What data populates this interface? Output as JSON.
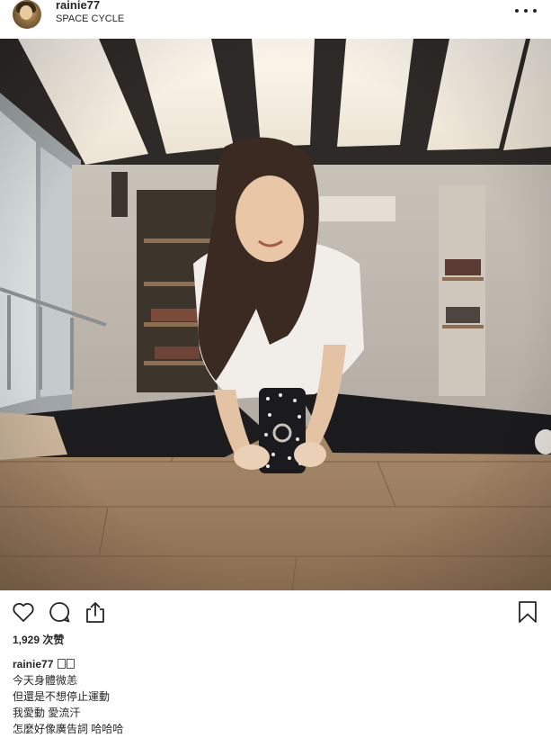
{
  "header": {
    "username": "rainie77",
    "location": "SPACE CYCLE"
  },
  "icons": {
    "like": "heart-icon",
    "comment": "comment-icon",
    "share": "share-icon",
    "save": "bookmark-icon",
    "more": "more-options-icon"
  },
  "likes": {
    "count": "1,929",
    "label": "次赞"
  },
  "caption": {
    "owner": "rainie77",
    "lines": [
      "今天身體微恙",
      "但還是不想停止運動",
      "我愛動 愛流汗",
      "怎麼好像廣告詞 哈哈哈"
    ]
  }
}
